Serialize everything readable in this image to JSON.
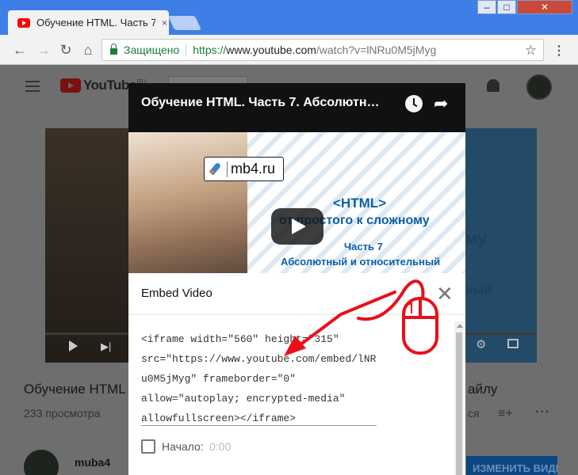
{
  "browser": {
    "tab_title": "Обучение HTML. Часть 7",
    "tab_close": "×",
    "win_min": "–",
    "win_max": "□",
    "win_close": "✕",
    "secure_label": "Защищено",
    "url_scheme": "https://",
    "url_host": "www.youtube.com",
    "url_path": "/watch?v=lNRu0M5jMyg",
    "back": "←",
    "forward": "→",
    "reload": "↻",
    "home": "⌂",
    "star": "☆",
    "menu": "⋮"
  },
  "youtube": {
    "logo_text": "YouTube",
    "logo_suffix": "RU",
    "video_title": "Обучение HTML",
    "video_title_end": "айлу",
    "views": "233 просмотра",
    "date_fragment": "ся",
    "channel": "muba4",
    "edit_button": "ИЗМЕНИТЬ ВИДЕО",
    "right_thumb_lines": [
      "му",
      "ный"
    ]
  },
  "share": {
    "title": "Обучение HTML. Часть 7. Абсолютн…",
    "thumbnail": {
      "watermark": "mb4.ru",
      "line1": "<HTML>",
      "line2": "от простого к сложному",
      "line3": "Часть 7",
      "line4": "Абсолютный и относительный"
    }
  },
  "embed": {
    "title": "Embed Video",
    "close": "✕",
    "code_lines": [
      "<iframe width=\"560\" height=\"315\"",
      "src=\"https://www.youtube.com/embed/lNR",
      "u0M5jMyg\" frameborder=\"0\"",
      "allow=\"autoplay; encrypted-media\"",
      "allowfullscreen></iframe>"
    ],
    "start_label": "Начало:",
    "start_time": "0:00"
  },
  "annotation": {
    "color": "#e8101a",
    "icon": "mouse-click-icon"
  }
}
